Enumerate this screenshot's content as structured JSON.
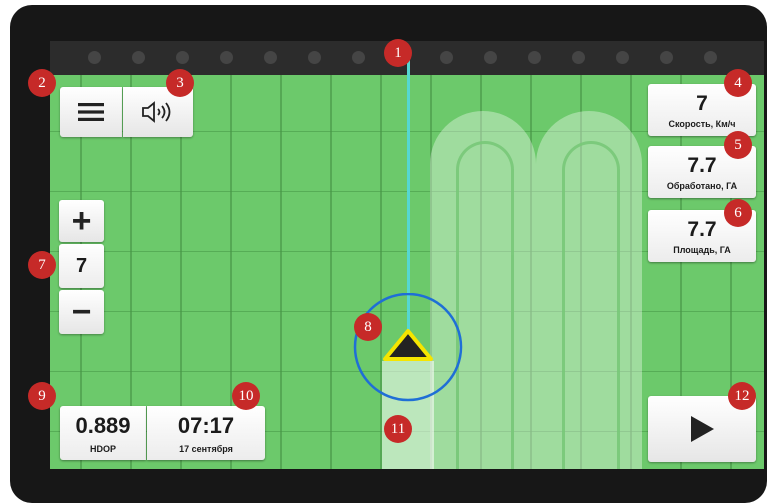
{
  "zoom": {
    "plus_label": "+",
    "minus_label": "−",
    "level": "7"
  },
  "stats": {
    "speed": {
      "value": "7",
      "label": "Скорость, Км/ч"
    },
    "processed": {
      "value": "7.7",
      "label": "Обработано, ГА"
    },
    "area": {
      "value": "7.7",
      "label": "Площадь, ГА"
    }
  },
  "gps": {
    "hdop_value": "0.889",
    "hdop_label": "HDOP"
  },
  "clock": {
    "time": "07:17",
    "date": "17 сентября"
  },
  "markers": [
    "1",
    "2",
    "3",
    "4",
    "5",
    "6",
    "7",
    "8",
    "9",
    "10",
    "11",
    "12"
  ],
  "icons": {
    "menu": "hamburger-menu-icon",
    "sound": "speaker-icon",
    "play": "play-icon",
    "vehicle": "vehicle-arrow-icon"
  },
  "colors": {
    "field": "#6cc96b",
    "guidance_line": "#55d7d2",
    "marker": "#c62a28",
    "position_circle": "#1f6fd6",
    "vehicle_outline": "#f5e500"
  }
}
